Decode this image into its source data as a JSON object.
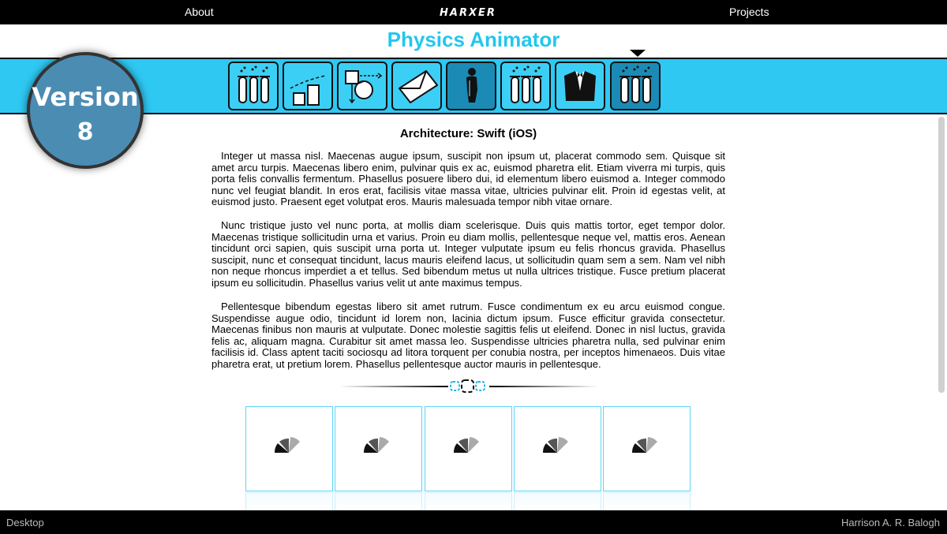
{
  "nav": {
    "about": "About",
    "brand": "HARXER",
    "projects": "Projects"
  },
  "app_title": "Physics Animator",
  "badge": {
    "line1": "Version",
    "line2": "8"
  },
  "toolbar": {
    "tools": [
      {
        "icon": "test-tubes-icon",
        "selected": false
      },
      {
        "icon": "growth-chart-icon",
        "selected": false
      },
      {
        "icon": "flow-diagram-icon",
        "selected": false
      },
      {
        "icon": "envelope-icon",
        "selected": false
      },
      {
        "icon": "person-silhouette-icon",
        "selected": true
      },
      {
        "icon": "test-tubes-icon",
        "selected": false
      },
      {
        "icon": "tuxedo-icon",
        "selected": false
      },
      {
        "icon": "test-tubes-icon",
        "selected": true
      }
    ]
  },
  "content": {
    "title": "Architecture: Swift (iOS)",
    "paragraphs": [
      "Integer ut massa nisl. Maecenas augue ipsum, suscipit non ipsum ut, placerat commodo sem. Quisque sit amet arcu turpis. Maecenas libero enim, pulvinar quis ex ac, euismod pharetra elit. Etiam viverra mi turpis, quis porta felis convallis fermentum. Phasellus posuere libero dui, id elementum libero euismod a. Integer commodo nunc vel feugiat blandit. In eros erat, facilisis vitae massa vitae, ultricies pulvinar elit. Proin id egestas velit, at euismod justo. Praesent eget volutpat eros. Mauris malesuada tempor nibh vitae ornare.",
      "Nunc tristique justo vel nunc porta, at mollis diam scelerisque. Duis quis mattis tortor, eget tempor dolor. Maecenas tristique sollicitudin urna et varius. Proin eu diam mollis, pellentesque neque vel, mattis eros. Aenean tincidunt orci sapien, quis suscipit urna porta ut. Integer vulputate ipsum eu felis rhoncus gravida. Phasellus suscipit, nunc et consequat tincidunt, lacus mauris eleifend lacus, ut sollicitudin quam sem a sem. Nam vel nibh non neque rhoncus imperdiet a et tellus. Sed bibendum metus ut nulla ultrices tristique. Fusce pretium placerat ipsum eu sollicitudin. Phasellus varius velit ut ante maximus tempus.",
      "Pellentesque bibendum egestas libero sit amet rutrum. Fusce condimentum ex eu arcu euismod congue. Suspendisse augue odio, tincidunt id lorem non, lacinia dictum ipsum. Fusce efficitur gravida consectetur. Maecenas finibus non mauris at vulputate. Donec molestie sagittis felis ut eleifend. Donec in nisl luctus, gravida felis ac, aliquam magna. Curabitur sit amet massa leo. Suspendisse ultricies pharetra nulla, sed pulvinar enim facilisis id. Class aptent taciti sociosqu ad litora torquent per conubia nostra, per inceptos himenaeos. Duis vitae pharetra erat, ut pretium lorem. Phasellus pellentesque auctor mauris in pellentesque."
    ]
  },
  "tiles": {
    "count": 5,
    "icon": "loading-spinner-icon"
  },
  "footer": {
    "left": "Desktop",
    "right": "Harrison A. R. Balogh"
  },
  "colors": {
    "accent": "#2ec8f3",
    "title": "#22c7ef",
    "badge": "#4b8cb3"
  }
}
